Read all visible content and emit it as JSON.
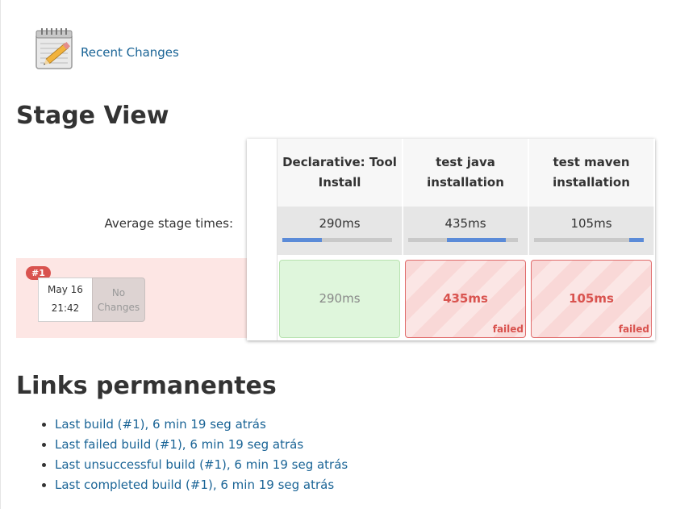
{
  "recent_changes": {
    "label": "Recent Changes",
    "icon": "notepad-icon"
  },
  "stage_view": {
    "title": "Stage View",
    "average_label": "Average stage times:",
    "stages": [
      {
        "name": "Declarative: Tool Install",
        "avg": "290ms",
        "bar_fill": 0.36,
        "bar_offset": 0.0
      },
      {
        "name": "test java installation",
        "avg": "435ms",
        "bar_fill": 0.54,
        "bar_offset": 0.35
      },
      {
        "name": "test maven installation",
        "avg": "105ms",
        "bar_fill": 0.13,
        "bar_offset": 0.87
      }
    ],
    "builds": [
      {
        "number": "#1",
        "date": "May 16",
        "time": "21:42",
        "changes": "No Changes",
        "cells": [
          {
            "value": "290ms",
            "status": "success",
            "tag": ""
          },
          {
            "value": "435ms",
            "status": "failed",
            "tag": "failed"
          },
          {
            "value": "105ms",
            "status": "failed",
            "tag": "failed"
          }
        ]
      }
    ],
    "colors": {
      "success": "#dff6dc",
      "failed": "#d9534f",
      "bar": "#5b8bd8"
    }
  },
  "permalinks": {
    "title": "Links permanentes",
    "items": [
      "Last build (#1), 6 min 19 seg atrás",
      "Last failed build (#1), 6 min 19 seg atrás",
      "Last unsuccessful build (#1), 6 min 19 seg atrás",
      "Last completed build (#1), 6 min 19 seg atrás"
    ]
  }
}
